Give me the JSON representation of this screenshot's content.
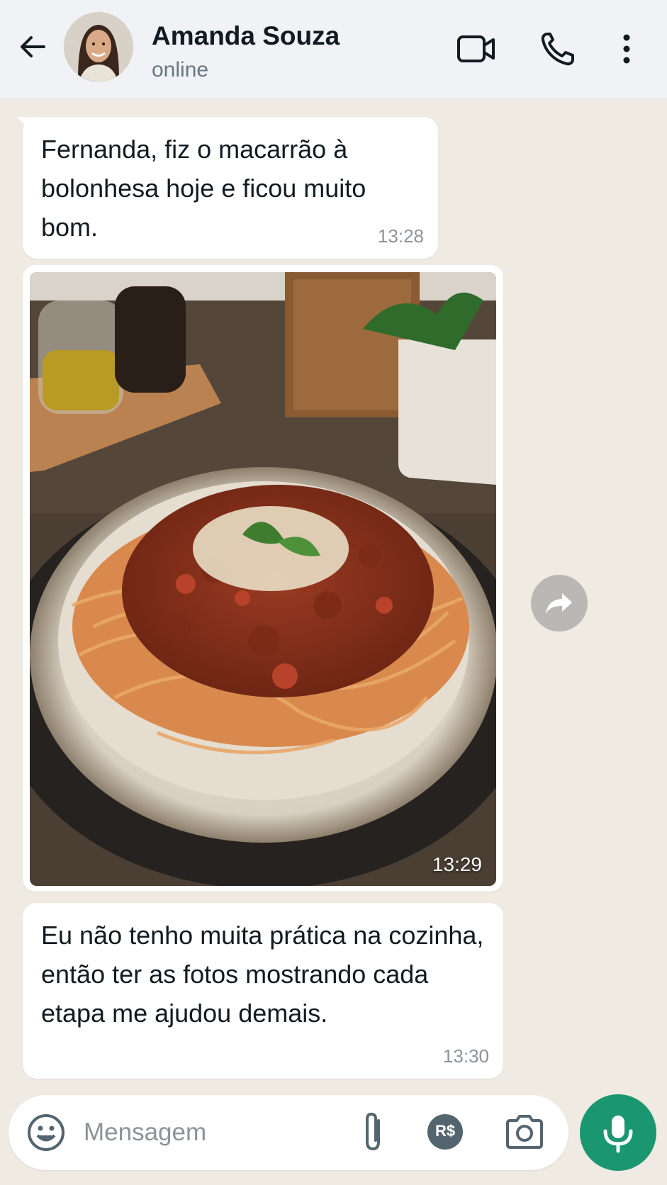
{
  "header": {
    "contact_name": "Amanda Souza",
    "status": "online"
  },
  "messages": [
    {
      "type": "text",
      "text": "Fernanda, fiz o macarrão à bolonhesa hoje e ficou muito bom.",
      "time": "13:28"
    },
    {
      "type": "image",
      "image_icon": "spaghetti-bolognese-photo",
      "time": "13:29"
    },
    {
      "type": "text",
      "text": "Eu não tenho muita prática na cozinha, então ter as fotos mostrando cada etapa me ajudou demais.",
      "time": "13:30"
    }
  ],
  "composer": {
    "placeholder": "Mensagem",
    "payment_label": "R$"
  },
  "colors": {
    "accent": "#1a9671",
    "chat_background": "#efeae2",
    "header_background": "#f0f2f5"
  }
}
